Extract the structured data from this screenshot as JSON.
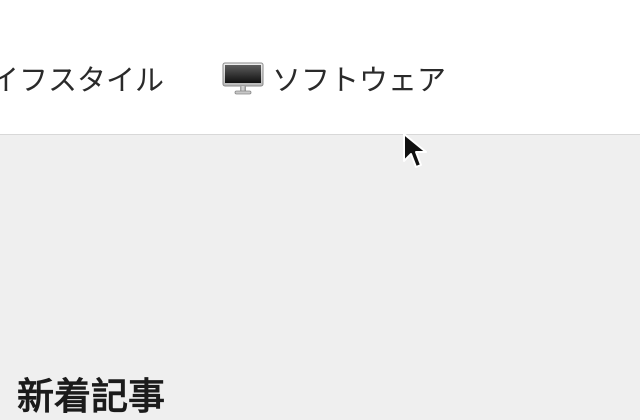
{
  "nav": {
    "items": [
      {
        "label": "イフスタイル"
      },
      {
        "label": "ソフトウェア",
        "icon": "monitor-icon"
      }
    ]
  },
  "main": {
    "section_title": "新着記事"
  },
  "colors": {
    "nav_background": "#ffffff",
    "page_background": "#eeeeee",
    "text": "#2a2a2a",
    "title_text": "#1b1b1b",
    "divider": "#d8d8d8"
  }
}
